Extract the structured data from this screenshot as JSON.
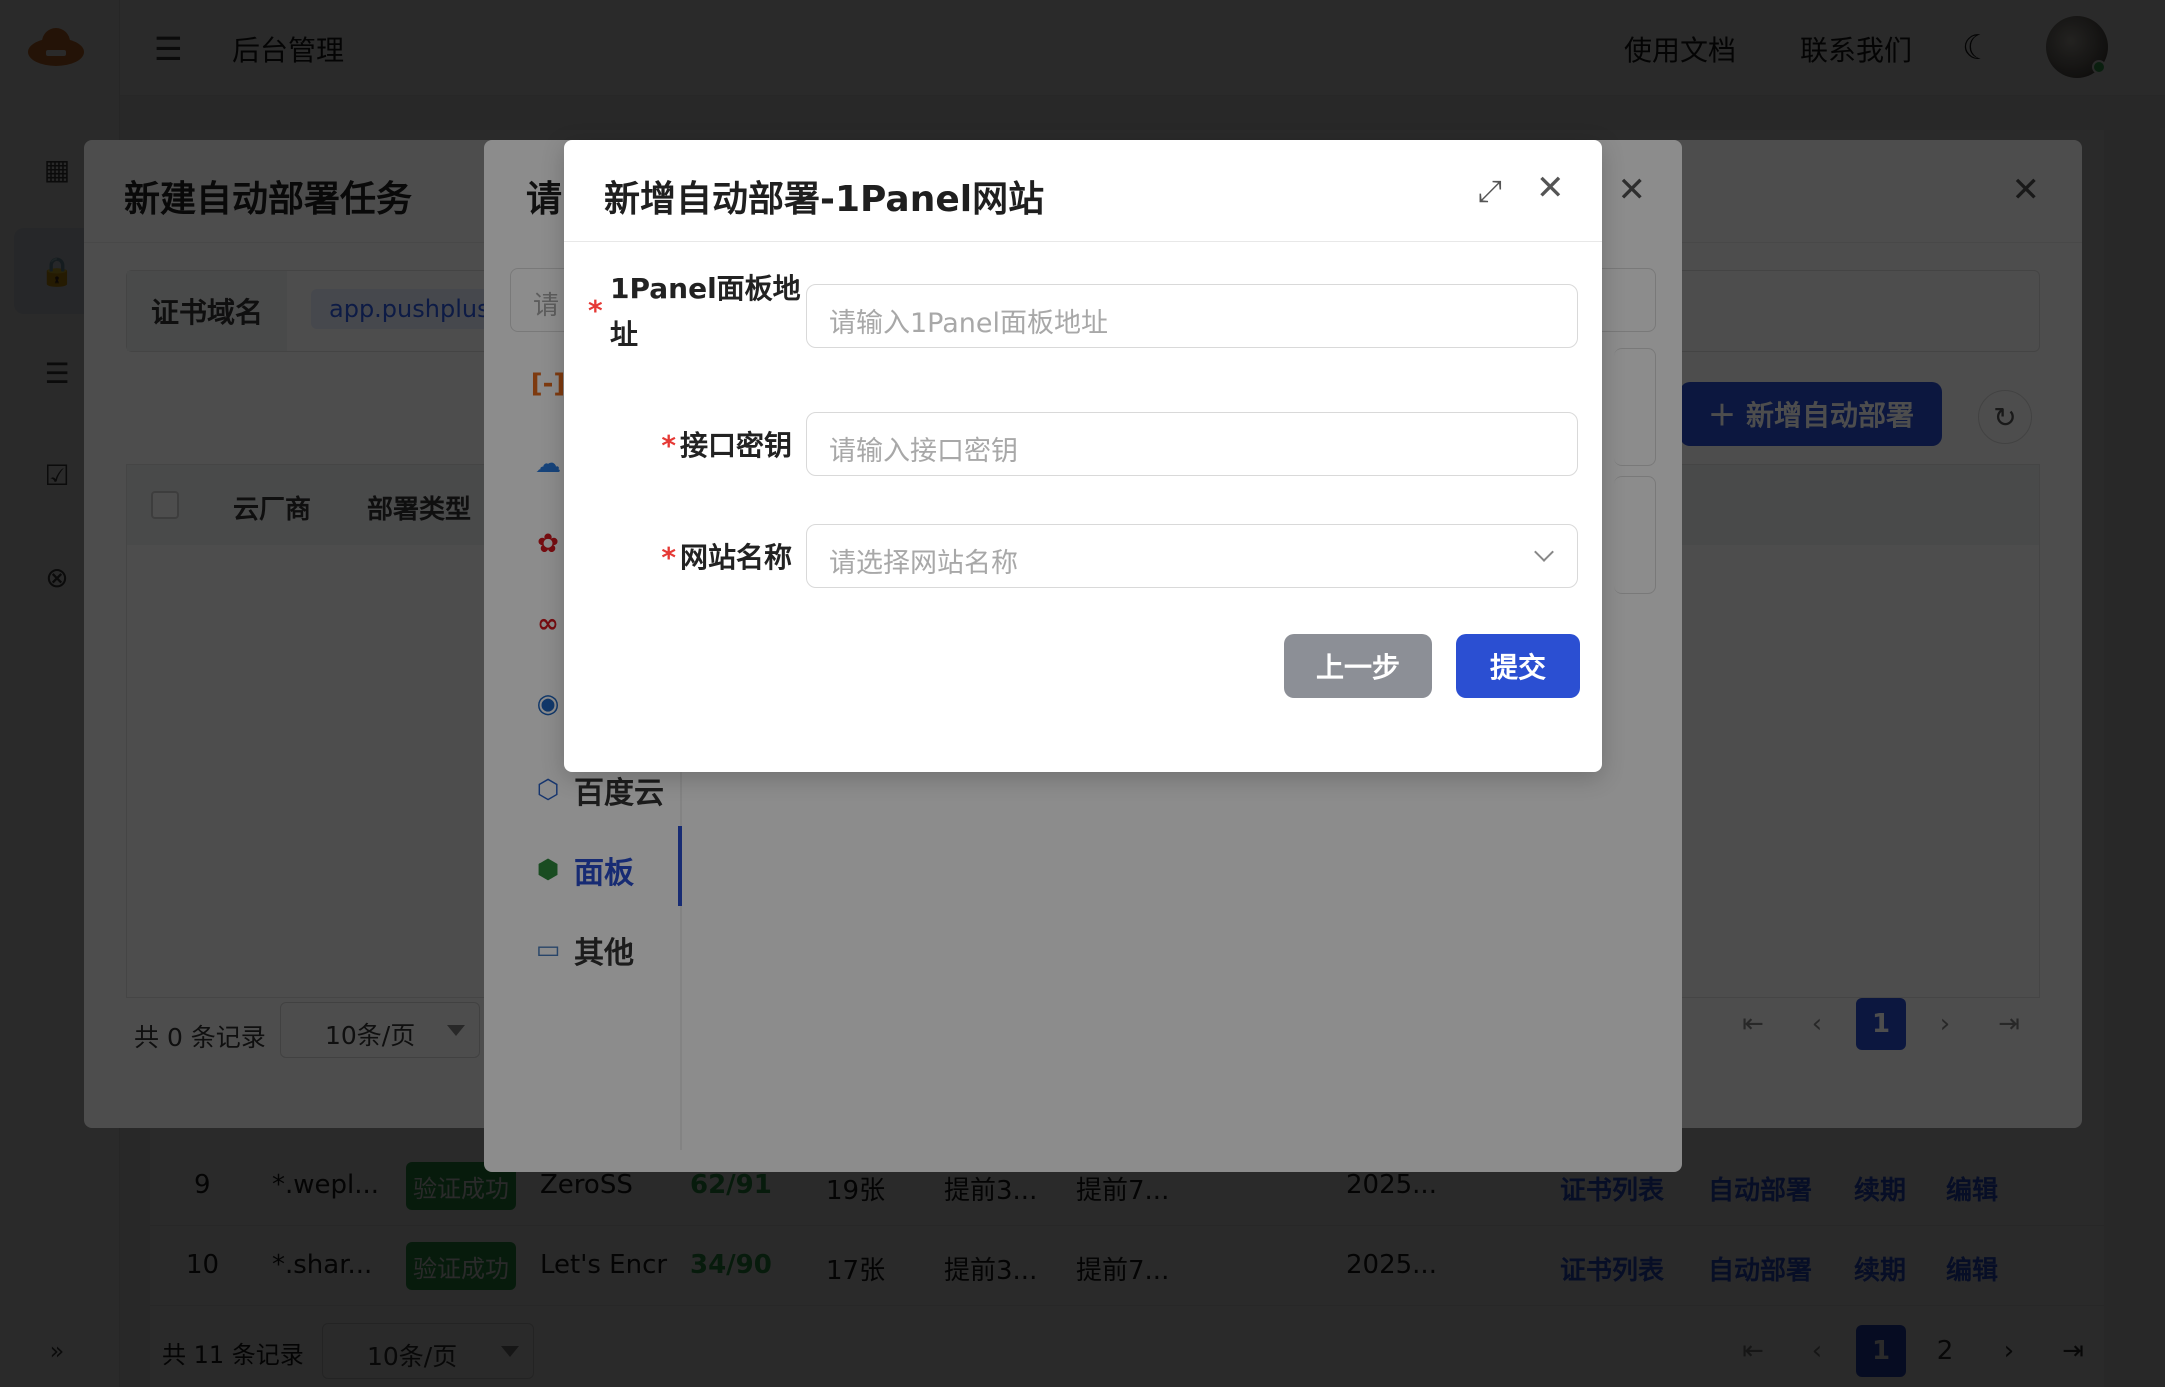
{
  "topbar": {
    "title": "后台管理",
    "docs": "使用文档",
    "contact": "联系我们"
  },
  "background_table": {
    "rows": [
      {
        "no": "9",
        "domain": "*.wepl...",
        "status": "验证成功",
        "vendor": "ZeroSS",
        "days": "62/91",
        "count": "19张",
        "remind1": "提前3...",
        "remind2": "提前7...",
        "date": "2025..."
      },
      {
        "no": "10",
        "domain": "*.shar...",
        "status": "验证成功",
        "vendor": "Let's Encr",
        "days": "34/90",
        "count": "17张",
        "remind1": "提前3...",
        "remind2": "提前7...",
        "date": "2025..."
      }
    ],
    "actions": [
      "证书列表",
      "自动部署",
      "续期",
      "编辑"
    ],
    "footer": {
      "total": "共 11 条记录",
      "page_size": "10条/页",
      "pages": [
        "1",
        "2"
      ]
    }
  },
  "dialog_task": {
    "title": "新建自动部署任务",
    "domain_label": "证书域名",
    "domain_value": "app.pushplus.p",
    "add_button": "新增自动部署",
    "columns": [
      "云厂商",
      "部署类型"
    ],
    "footer": {
      "total": "共 0 条记录",
      "page_size": "10条/页",
      "page": "1"
    }
  },
  "dialog_vendor": {
    "title": "请",
    "search_placeholder": "请",
    "vendors": [
      {
        "name": "",
        "icon": "aliyun-icon"
      },
      {
        "name": "",
        "icon": "tencent-cloud-icon"
      },
      {
        "name": "",
        "icon": "huawei-icon"
      },
      {
        "name": "",
        "icon": "volcengine-icon"
      },
      {
        "name": "",
        "icon": "qiniu-icon"
      },
      {
        "name": "百度云",
        "icon": "baidu-cloud-icon"
      },
      {
        "name": "面板",
        "icon": "panel-icon"
      },
      {
        "name": "其他",
        "icon": "other-icon"
      }
    ]
  },
  "dialog_form": {
    "title": "新增自动部署-1Panel网站",
    "fields": [
      {
        "label_line1": "1Panel面板地",
        "label_line2": "址",
        "placeholder": "请输入1Panel面板地址"
      },
      {
        "label": "接口密钥",
        "placeholder": "请输入接口密钥"
      },
      {
        "label": "网站名称",
        "placeholder": "请选择网站名称"
      }
    ],
    "required_mark": "*",
    "prev_button": "上一步",
    "submit_button": "提交"
  },
  "colors": {
    "primary": "#2b4fd2",
    "success": "#2fa84f",
    "required": "#e53935"
  }
}
